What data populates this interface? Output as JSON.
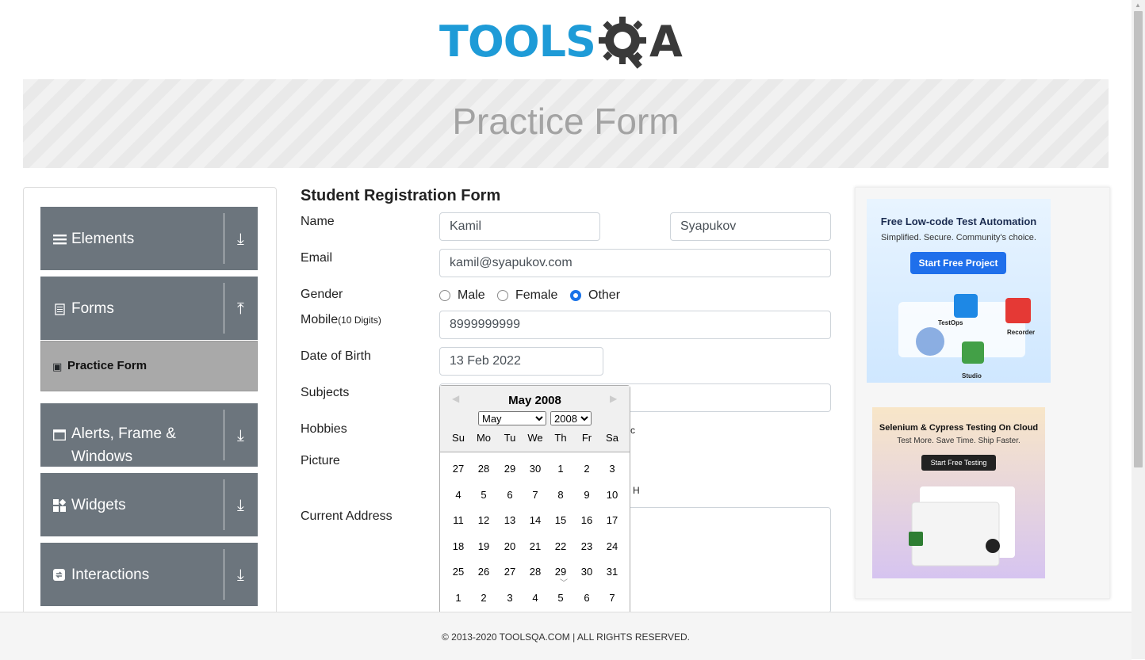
{
  "logo": {
    "tools_text": "TOOLS",
    "qa_text": "A"
  },
  "banner": {
    "title": "Practice Form"
  },
  "sidebar": {
    "groups": [
      {
        "label": "Elements",
        "icon": "hamburger-icon",
        "arrow": "download-icon"
      },
      {
        "label": "Forms",
        "icon": "document-icon",
        "arrow": "upload-icon"
      },
      {
        "label": "Alerts, Frame & Windows",
        "icon": "window-icon",
        "arrow": "download-icon"
      },
      {
        "label": "Widgets",
        "icon": "widgets-icon",
        "arrow": "download-icon"
      },
      {
        "label": "Interactions",
        "icon": "interactions-icon",
        "arrow": "download-icon"
      }
    ],
    "active_item": {
      "label": "Practice Form",
      "icon": "html-icon"
    }
  },
  "form": {
    "title": "Student Registration Form",
    "name_label": "Name",
    "first_name": "Kamil",
    "last_name": "Syapukov",
    "email_label": "Email",
    "email": "kamil@syapukov.com",
    "gender_label": "Gender",
    "gender_options": [
      "Male",
      "Female",
      "Other"
    ],
    "gender_selected": "Other",
    "mobile_label": "Mobile",
    "mobile_hint": "(10 Digits)",
    "mobile": "8999999999",
    "dob_label": "Date of Birth",
    "dob": "13 Feb 2022",
    "subjects_label": "Subjects",
    "hobbies_label": "Hobbies",
    "hobbies_peek": "c",
    "picture_label": "Picture",
    "picture_peek": "H",
    "address_label": "Current Address"
  },
  "datepicker": {
    "title": "May 2008",
    "month_selected": "May",
    "year_selected": "2008",
    "weekdays": [
      "Su",
      "Mo",
      "Tu",
      "We",
      "Th",
      "Fr",
      "Sa"
    ],
    "weeks": [
      [
        "27",
        "28",
        "29",
        "30",
        "1",
        "2",
        "3"
      ],
      [
        "4",
        "5",
        "6",
        "7",
        "8",
        "9",
        "10"
      ],
      [
        "11",
        "12",
        "13",
        "14",
        "15",
        "16",
        "17"
      ],
      [
        "18",
        "19",
        "20",
        "21",
        "22",
        "23",
        "24"
      ],
      [
        "25",
        "26",
        "27",
        "28",
        "29",
        "30",
        "31"
      ],
      [
        "1",
        "2",
        "3",
        "4",
        "5",
        "6",
        "7"
      ]
    ]
  },
  "ads": {
    "ad1": {
      "title": "Free Low-code Test Automation",
      "subtitle": "Simplified. Secure. Community's choice.",
      "button": "Start Free Project",
      "tags": [
        "TestOps",
        "Recorder",
        "Studio"
      ]
    },
    "ad2": {
      "title": "Selenium & Cypress Testing On Cloud",
      "subtitle": "Test More. Save Time. Ship Faster.",
      "button": "Start Free Testing"
    }
  },
  "footer": {
    "text": "© 2013-2020 TOOLSQA.COM | ALL RIGHTS RESERVED."
  }
}
